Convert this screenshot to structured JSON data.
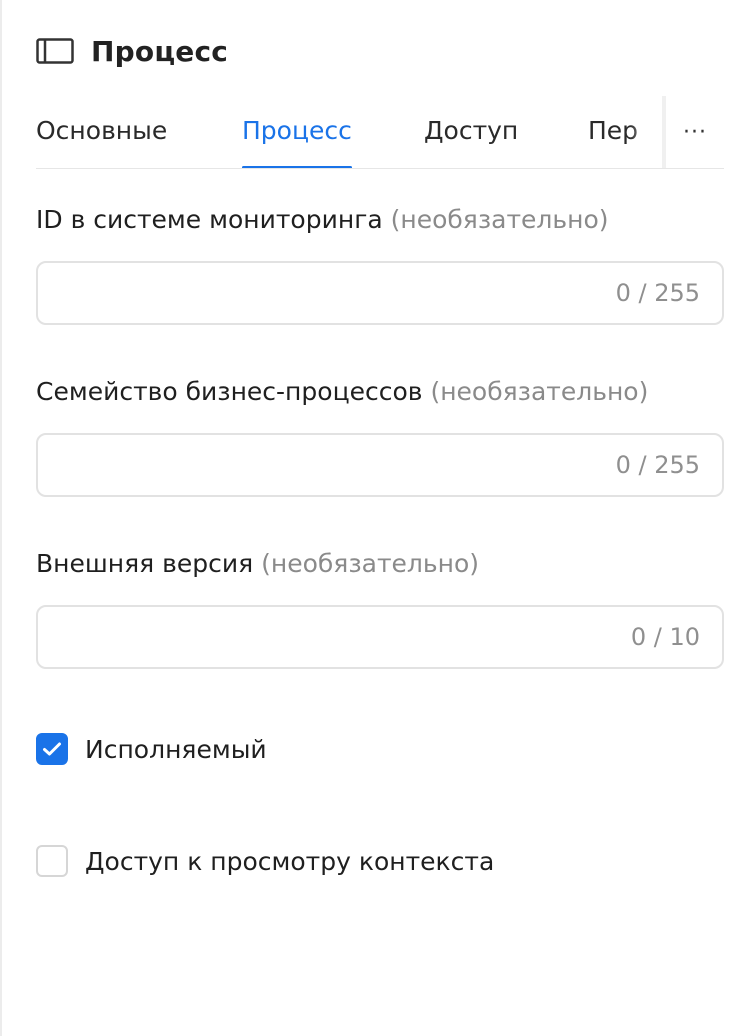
{
  "header": {
    "title": "Процесс",
    "icon": "panel-sidebar-icon"
  },
  "tabs": [
    {
      "label": "Основные",
      "active": false
    },
    {
      "label": "Процесс",
      "active": true
    },
    {
      "label": "Доступ",
      "active": false
    },
    {
      "label": "Пер",
      "active": false
    }
  ],
  "tabs_more_label": "···",
  "fields": {
    "monitoring_id": {
      "label": "ID в системе мониторинга",
      "optional": "(необязательно)",
      "value": "",
      "counter": "0 / 255"
    },
    "process_family": {
      "label": "Семейство бизнес-процессов",
      "optional": "(необязательно)",
      "value": "",
      "counter": "0 / 255"
    },
    "external_version": {
      "label": "Внешняя версия",
      "optional": "(необязательно)",
      "value": "",
      "counter": "0 / 10"
    }
  },
  "checkboxes": {
    "executable": {
      "label": "Исполняемый",
      "checked": true
    },
    "context_access": {
      "label": "Доступ к просмотру контекста",
      "checked": false
    }
  },
  "colors": {
    "accent": "#1a73e8",
    "muted_text": "#8a8a8a",
    "border": "#e2e2e2"
  }
}
